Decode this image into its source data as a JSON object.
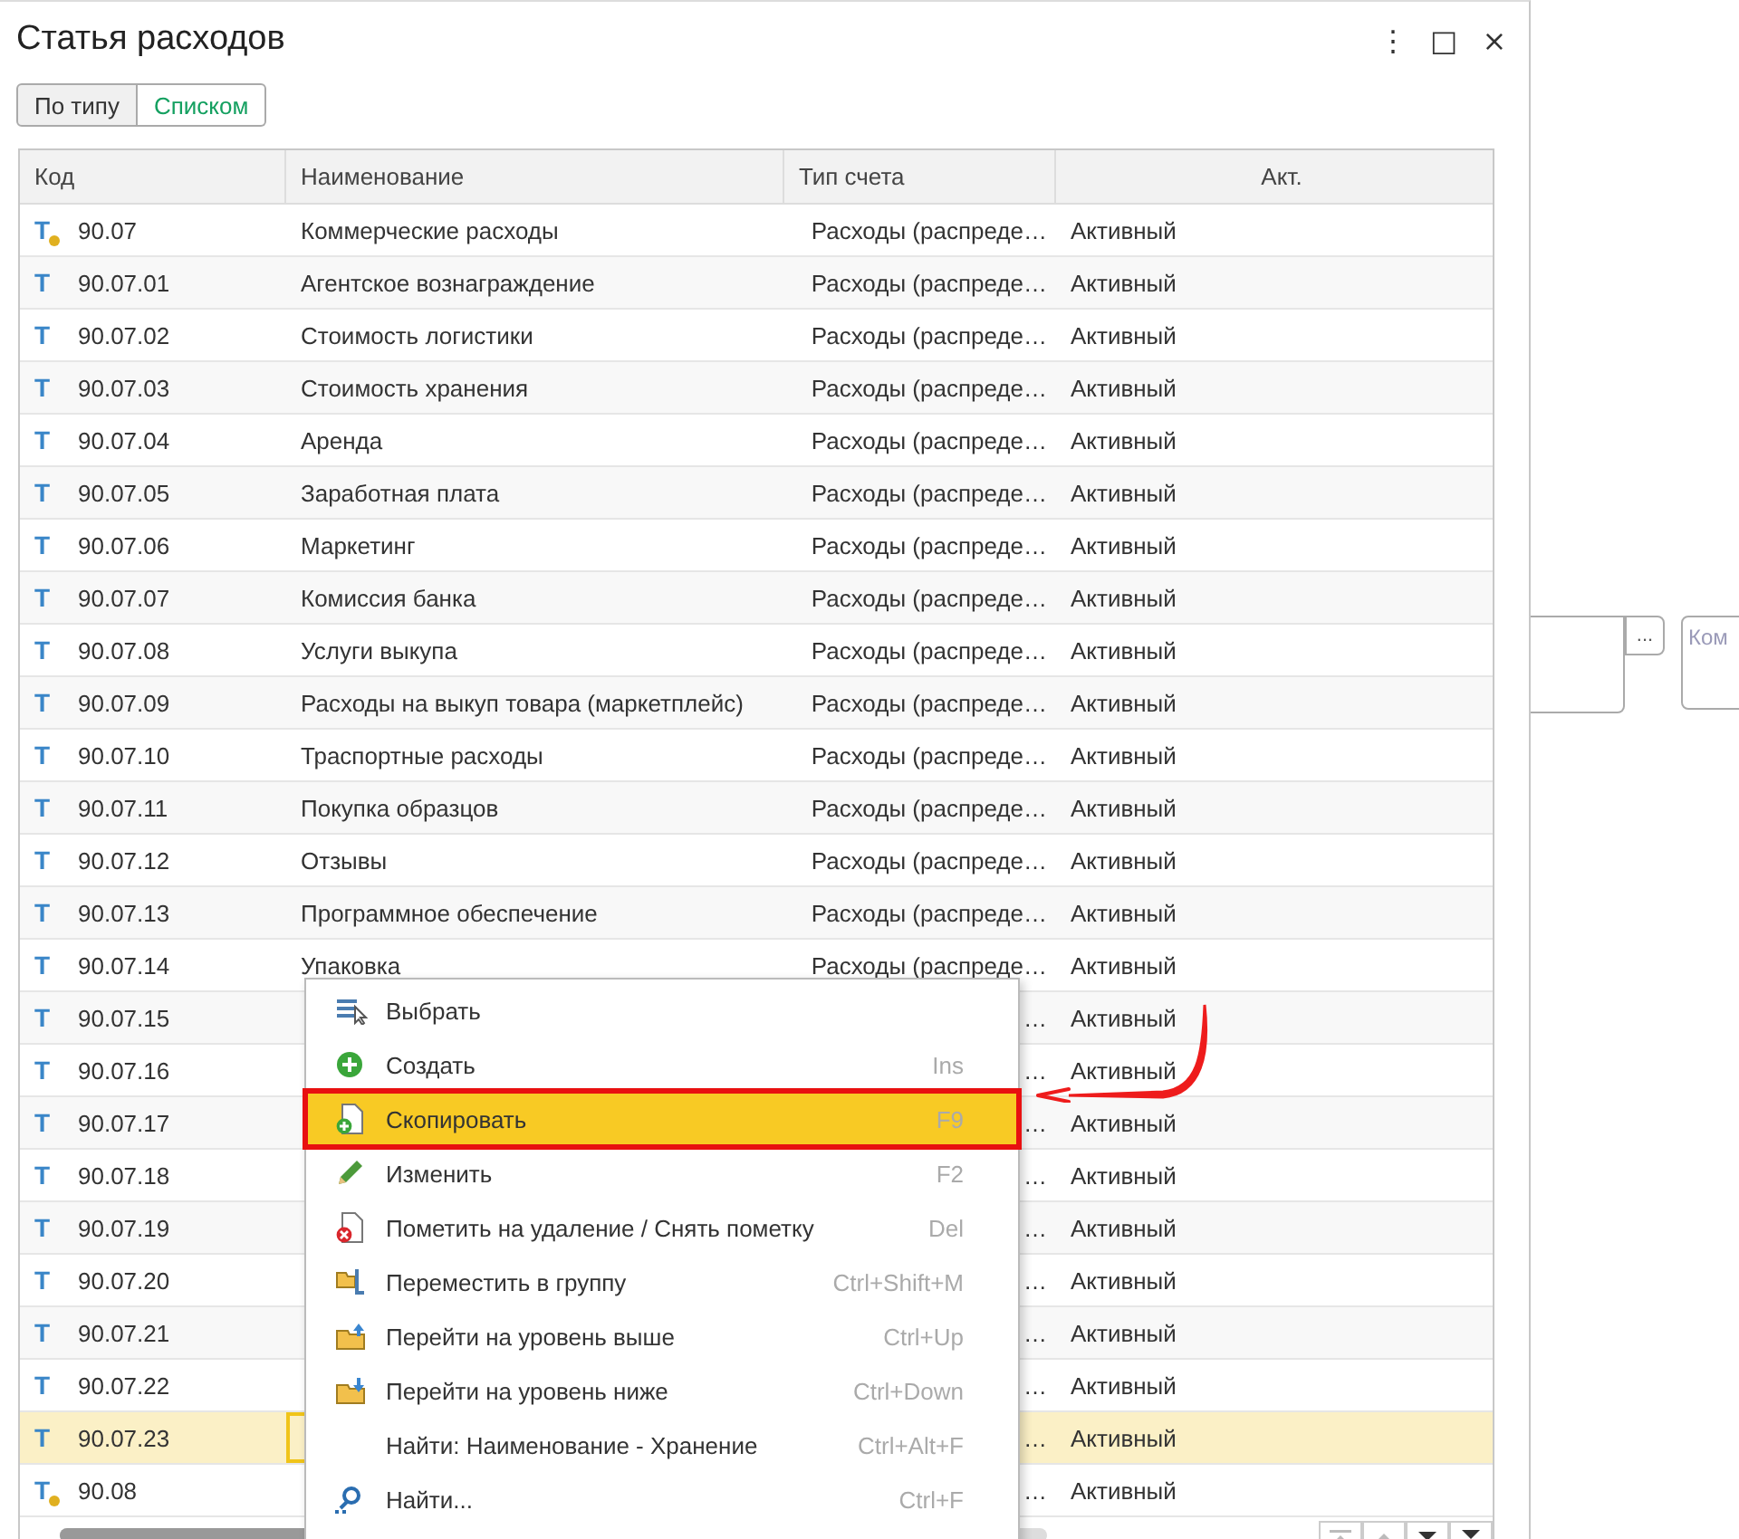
{
  "window": {
    "title": "Статья расходов",
    "controls": [
      "⋮",
      "□",
      "×"
    ]
  },
  "view_switch": [
    {
      "label": "По типу",
      "selected": false
    },
    {
      "label": "Списком",
      "selected": true
    }
  ],
  "table": {
    "columns": [
      "Код",
      "Наименование",
      "Тип счета",
      "Акт."
    ],
    "rows": [
      {
        "mark": "Т",
        "group": true,
        "code": "90.07",
        "name": "Коммерческие расходы",
        "type": "Расходы (распреде…",
        "activity": "Активный",
        "selected": false
      },
      {
        "mark": "Т",
        "group": false,
        "code": "90.07.01",
        "name": "Агентское вознаграждение",
        "type": "Расходы (распреде…",
        "activity": "Активный",
        "selected": false
      },
      {
        "mark": "Т",
        "group": false,
        "code": "90.07.02",
        "name": "Стоимость логистики",
        "type": "Расходы (распреде…",
        "activity": "Активный",
        "selected": false
      },
      {
        "mark": "Т",
        "group": false,
        "code": "90.07.03",
        "name": "Стоимость хранения",
        "type": "Расходы (распреде…",
        "activity": "Активный",
        "selected": false
      },
      {
        "mark": "Т",
        "group": false,
        "code": "90.07.04",
        "name": "Аренда",
        "type": "Расходы (распреде…",
        "activity": "Активный",
        "selected": false
      },
      {
        "mark": "Т",
        "group": false,
        "code": "90.07.05",
        "name": "Заработная плата",
        "type": "Расходы (распреде…",
        "activity": "Активный",
        "selected": false
      },
      {
        "mark": "Т",
        "group": false,
        "code": "90.07.06",
        "name": "Маркетинг",
        "type": "Расходы (распреде…",
        "activity": "Активный",
        "selected": false
      },
      {
        "mark": "Т",
        "group": false,
        "code": "90.07.07",
        "name": "Комиссия банка",
        "type": "Расходы (распреде…",
        "activity": "Активный",
        "selected": false
      },
      {
        "mark": "Т",
        "group": false,
        "code": "90.07.08",
        "name": "Услуги выкупа",
        "type": "Расходы (распреде…",
        "activity": "Активный",
        "selected": false
      },
      {
        "mark": "Т",
        "group": false,
        "code": "90.07.09",
        "name": "Расходы на выкуп товара (маркетплейс)",
        "type": "Расходы (распреде…",
        "activity": "Активный",
        "selected": false
      },
      {
        "mark": "Т",
        "group": false,
        "code": "90.07.10",
        "name": "Траспортные расходы",
        "type": "Расходы (распреде…",
        "activity": "Активный",
        "selected": false
      },
      {
        "mark": "Т",
        "group": false,
        "code": "90.07.11",
        "name": "Покупка образцов",
        "type": "Расходы (распреде…",
        "activity": "Активный",
        "selected": false
      },
      {
        "mark": "Т",
        "group": false,
        "code": "90.07.12",
        "name": "Отзывы",
        "type": "Расходы (распреде…",
        "activity": "Активный",
        "selected": false
      },
      {
        "mark": "Т",
        "group": false,
        "code": "90.07.13",
        "name": "Программное обеспечение",
        "type": "Расходы (распреде…",
        "activity": "Активный",
        "selected": false
      },
      {
        "mark": "Т",
        "group": false,
        "code": "90.07.14",
        "name": "Упаковка",
        "type": "Расходы (распреде…",
        "activity": "Активный",
        "selected": false
      },
      {
        "mark": "Т",
        "group": false,
        "code": "90.07.15",
        "type": "…",
        "activity": "Активный",
        "selected": false
      },
      {
        "mark": "Т",
        "group": false,
        "code": "90.07.16",
        "type": "…",
        "activity": "Активный",
        "selected": false
      },
      {
        "mark": "Т",
        "group": false,
        "code": "90.07.17",
        "type": "…",
        "activity": "Активный",
        "selected": false
      },
      {
        "mark": "Т",
        "group": false,
        "code": "90.07.18",
        "type": "…",
        "activity": "Активный",
        "selected": false
      },
      {
        "mark": "Т",
        "group": false,
        "code": "90.07.19",
        "type": "…",
        "activity": "Активный",
        "selected": false
      },
      {
        "mark": "Т",
        "group": false,
        "code": "90.07.20",
        "type": "…",
        "activity": "Активный",
        "selected": false
      },
      {
        "mark": "Т",
        "group": false,
        "code": "90.07.21",
        "type": "…",
        "activity": "Активный",
        "selected": false
      },
      {
        "mark": "Т",
        "group": false,
        "code": "90.07.22",
        "type": "…",
        "activity": "Активный",
        "selected": false
      },
      {
        "mark": "Т",
        "group": false,
        "code": "90.07.23",
        "type": "…",
        "activity": "Активный",
        "selected": true
      },
      {
        "mark": "Т",
        "group": true,
        "code": "90.08",
        "type": "…",
        "activity": "Активный",
        "selected": false
      }
    ]
  },
  "context_menu": [
    {
      "kind": "select",
      "label": "Выбрать",
      "selected": false
    },
    {
      "kind": "create",
      "label": "Создать",
      "shortcut": "Ins",
      "selected": false
    },
    {
      "kind": "copy",
      "label": "Скопировать",
      "shortcut": "F9",
      "selected": true
    },
    {
      "kind": "edit",
      "label": "Изменить",
      "shortcut": "F2",
      "selected": false
    },
    {
      "kind": "delete",
      "label": "Пометить на удаление / Снять пометку",
      "shortcut": "Del",
      "selected": false
    },
    {
      "kind": "move",
      "label": "Переместить в группу",
      "shortcut": "Ctrl+Shift+M",
      "selected": false
    },
    {
      "kind": "up",
      "label": "Перейти на уровень выше",
      "shortcut": "Ctrl+Up",
      "selected": false
    },
    {
      "kind": "down",
      "label": "Перейти на уровень ниже",
      "shortcut": "Ctrl+Down",
      "selected": false
    },
    {
      "kind": "search",
      "label": "Найти: Наименование - Хранение",
      "shortcut": "Ctrl+Alt+F",
      "selected": false
    },
    {
      "kind": "find",
      "label": "Найти...",
      "shortcut": "Ctrl+F",
      "selected": false
    }
  ],
  "background_form": {
    "select_button": "...",
    "comment_placeholder": "Ком"
  }
}
